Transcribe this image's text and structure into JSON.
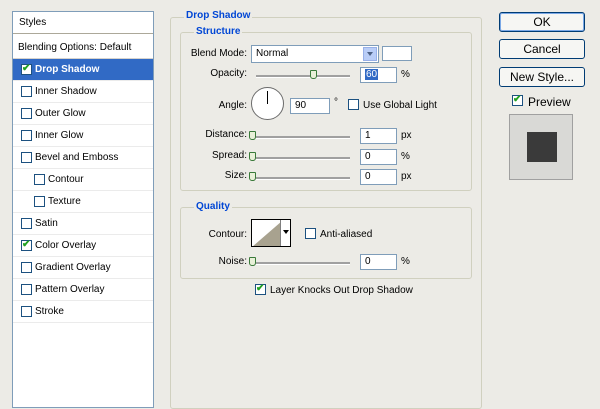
{
  "styles_panel": {
    "header": "Styles",
    "items": [
      {
        "label": "Blending Options: Default",
        "type": "header",
        "checked": false
      },
      {
        "label": "Drop Shadow",
        "type": "check",
        "checked": true,
        "selected": true
      },
      {
        "label": "Inner Shadow",
        "type": "check",
        "checked": false
      },
      {
        "label": "Outer Glow",
        "type": "check",
        "checked": false
      },
      {
        "label": "Inner Glow",
        "type": "check",
        "checked": false
      },
      {
        "label": "Bevel and Emboss",
        "type": "check",
        "checked": false
      },
      {
        "label": "Contour",
        "type": "check",
        "checked": false,
        "sub": true
      },
      {
        "label": "Texture",
        "type": "check",
        "checked": false,
        "sub": true
      },
      {
        "label": "Satin",
        "type": "check",
        "checked": false
      },
      {
        "label": "Color Overlay",
        "type": "check",
        "checked": true
      },
      {
        "label": "Gradient Overlay",
        "type": "check",
        "checked": false
      },
      {
        "label": "Pattern Overlay",
        "type": "check",
        "checked": false
      },
      {
        "label": "Stroke",
        "type": "check",
        "checked": false
      }
    ]
  },
  "drop_shadow": {
    "title": "Drop Shadow",
    "structure": {
      "title": "Structure",
      "blend_mode_label": "Blend Mode:",
      "blend_mode_value": "Normal",
      "opacity_label": "Opacity:",
      "opacity_value": "60",
      "opacity_unit": "%",
      "angle_label": "Angle:",
      "angle_value": "90",
      "angle_unit": "°",
      "global_light_label": "Use Global Light",
      "global_light_checked": false,
      "distance_label": "Distance:",
      "distance_value": "1",
      "distance_unit": "px",
      "spread_label": "Spread:",
      "spread_value": "0",
      "spread_unit": "%",
      "size_label": "Size:",
      "size_value": "0",
      "size_unit": "px"
    },
    "quality": {
      "title": "Quality",
      "contour_label": "Contour:",
      "anti_aliased_label": "Anti-aliased",
      "anti_aliased_checked": false,
      "noise_label": "Noise:",
      "noise_value": "0",
      "noise_unit": "%"
    },
    "knockout_label": "Layer Knocks Out Drop Shadow",
    "knockout_checked": true
  },
  "buttons": {
    "ok": "OK",
    "cancel": "Cancel",
    "new_style": "New Style...",
    "preview_label": "Preview",
    "preview_checked": true
  },
  "colors": {
    "accent": "#316ac5",
    "group_title": "#0046d5",
    "check": "#21a121",
    "preview_swatch": "#3a3a3a"
  }
}
